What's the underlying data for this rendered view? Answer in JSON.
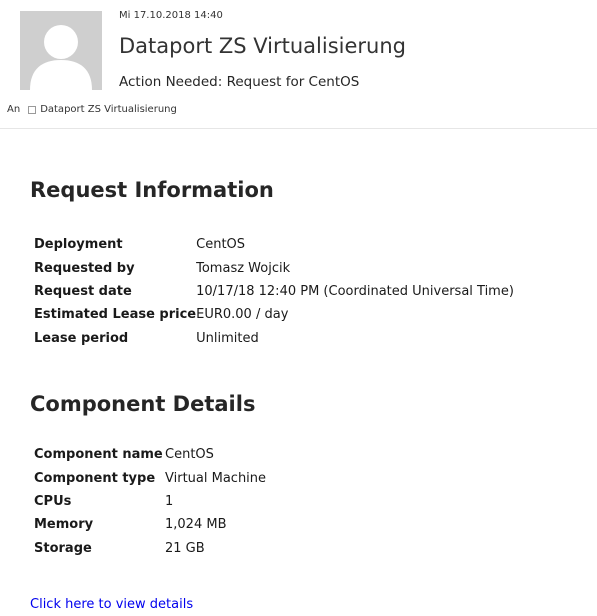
{
  "header": {
    "date": "Mi 17.10.2018 14:40",
    "sender": "Dataport ZS Virtualisierung",
    "subject": "Action Needed: Request for CentOS",
    "to_label": "An",
    "to_recipient": "Dataport ZS Virtualisierung"
  },
  "request_info": {
    "title": "Request Information",
    "rows": [
      {
        "label": "Deployment",
        "value": "CentOS"
      },
      {
        "label": "Requested by",
        "value": "Tomasz Wojcik"
      },
      {
        "label": "Request date",
        "value": "10/17/18 12:40 PM (Coordinated Universal Time)"
      },
      {
        "label": "Estimated Lease price",
        "value": "EUR0.00 / day"
      },
      {
        "label": "Lease period",
        "value": "Unlimited"
      }
    ]
  },
  "component_details": {
    "title": "Component Details",
    "rows": [
      {
        "label": "Component name",
        "value": "CentOS"
      },
      {
        "label": "Component type",
        "value": "Virtual Machine"
      },
      {
        "label": "CPUs",
        "value": "1"
      },
      {
        "label": "Memory",
        "value": "1,024 MB"
      },
      {
        "label": "Storage",
        "value": "21 GB"
      }
    ]
  },
  "link_text": "Click here to view details",
  "colors": {
    "link": "#0000ee",
    "avatar_bg": "#cfcfcf",
    "avatar_fg": "#ffffff"
  },
  "icons": {
    "avatar": "person-placeholder-icon",
    "recipient": "checkbox-icon"
  }
}
